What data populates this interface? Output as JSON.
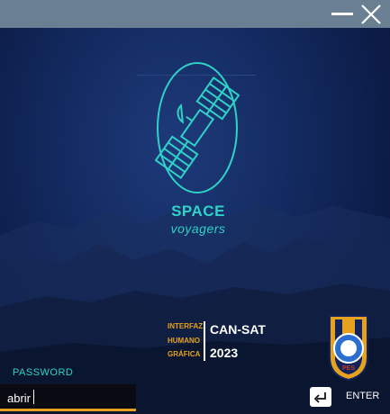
{
  "window": {
    "controls": [
      "minimize-icon",
      "close-icon"
    ]
  },
  "brand": {
    "title": "SPACE",
    "subtitle": "voyagers",
    "icon": "satellite-icon"
  },
  "event": {
    "subtitle_line1": "INTERFAZ",
    "subtitle_line2": "HUMANO",
    "subtitle_line3": "GRÁFICA",
    "name": "CAN-SAT",
    "year": "2023",
    "crest_text": "PES"
  },
  "login": {
    "password_label": "PASSWORD",
    "password_value": "abrir",
    "enter_label": "ENTER",
    "enter_icon": "enter-return-icon"
  },
  "colors": {
    "accent_teal": "#2fd2c6",
    "accent_orange": "#e6a11e",
    "titlebar": "#6b7f93"
  }
}
